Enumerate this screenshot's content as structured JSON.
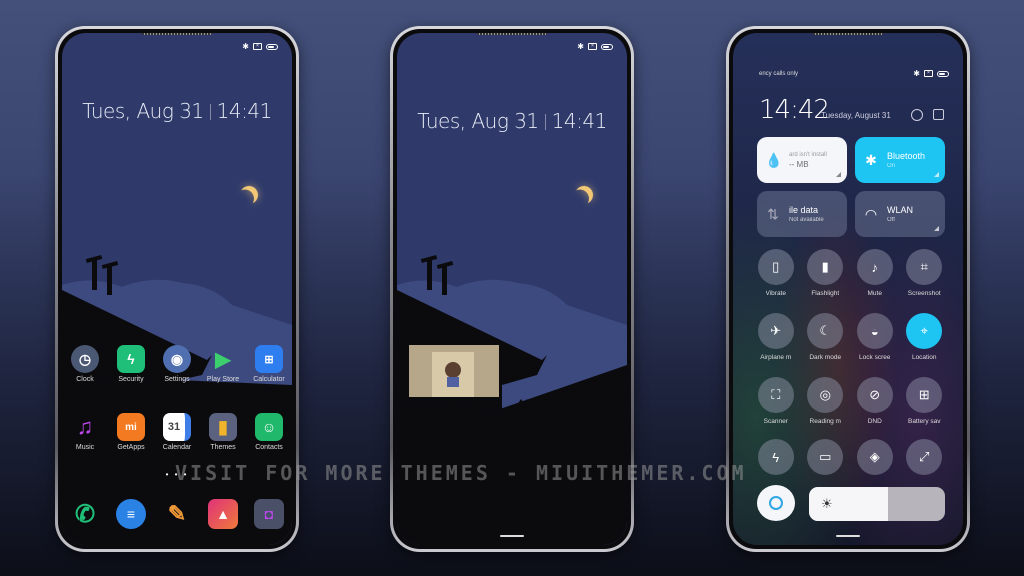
{
  "watermark": "VISIT FOR MORE THEMES - MIUITHEMER.COM",
  "phone1": {
    "status_icons": [
      "bluetooth-icon",
      "sim-icon",
      "battery-icon"
    ],
    "date": "Tues, Aug 31",
    "time": "14:41",
    "apps_row1": [
      {
        "label": "Clock",
        "icon": "clock-icon",
        "color": "#4b5873"
      },
      {
        "label": "Security",
        "icon": "security-icon",
        "color": "#1fbf7a"
      },
      {
        "label": "Settings",
        "icon": "settings-icon",
        "color": "#4f6fb0"
      },
      {
        "label": "Play Store",
        "icon": "play-store-icon",
        "color": "#2a2f40"
      },
      {
        "label": "Calculator",
        "icon": "calculator-icon",
        "color": "#2f7ef0"
      }
    ],
    "apps_row2": [
      {
        "label": "Music",
        "icon": "music-icon",
        "color": "#b43ce0"
      },
      {
        "label": "GetApps",
        "icon": "getapps-icon",
        "color": "#f37a20"
      },
      {
        "label": "Calendar",
        "icon": "calendar-icon",
        "color": "#ffffff"
      },
      {
        "label": "Themes",
        "icon": "themes-icon",
        "color": "#f2b42a"
      },
      {
        "label": "Contacts",
        "icon": "contacts-icon",
        "color": "#20b86a"
      }
    ],
    "calendar_day": "31",
    "dock": [
      {
        "icon": "phone-icon",
        "color": "#1fbf7a"
      },
      {
        "icon": "messages-icon",
        "color": "#2a82e4"
      },
      {
        "icon": "notes-icon",
        "color": "#f29a38"
      },
      {
        "icon": "gallery-icon",
        "color": "#e0327a"
      },
      {
        "icon": "camera-icon",
        "color": "#4a5068"
      }
    ],
    "page_dots": "• • •"
  },
  "phone2": {
    "status_icons": [
      "bluetooth-icon",
      "sim-icon",
      "battery-icon"
    ],
    "date": "Tues, Aug 31",
    "time": "14:41"
  },
  "phone3": {
    "carrier": "ency calls only",
    "time": "14:42",
    "date": "Tuesday, August 31",
    "tiles": {
      "storage": {
        "title": "ard isn't install",
        "sub": "-- MB"
      },
      "bluetooth": {
        "title": "Bluetooth",
        "sub": "On"
      },
      "mobile_data": {
        "title": "ile data",
        "sub": "Not available"
      },
      "wlan": {
        "title": "WLAN",
        "sub": "Off"
      }
    },
    "toggles_row1": [
      {
        "label": "Vibrate",
        "icon": "vibrate-icon",
        "active": false
      },
      {
        "label": "Flashlight",
        "icon": "flashlight-icon",
        "active": false
      },
      {
        "label": "Mute",
        "icon": "mute-icon",
        "active": false
      },
      {
        "label": "Screenshot",
        "icon": "screenshot-icon",
        "active": false
      }
    ],
    "toggles_row2": [
      {
        "label": "Airplane m",
        "icon": "airplane-icon",
        "active": false
      },
      {
        "label": "Dark mode",
        "icon": "dark-mode-icon",
        "active": false
      },
      {
        "label": "Lock scree",
        "icon": "lock-screen-icon",
        "active": false
      },
      {
        "label": "Location",
        "icon": "location-icon",
        "active": true
      }
    ],
    "toggles_row3": [
      {
        "label": "Scanner",
        "icon": "scanner-icon",
        "active": false
      },
      {
        "label": "Reading m",
        "icon": "reading-mode-icon",
        "active": false
      },
      {
        "label": "DND",
        "icon": "dnd-icon",
        "active": false
      },
      {
        "label": "Battery sav",
        "icon": "battery-saver-icon",
        "active": false
      }
    ],
    "toggles_row4": [
      {
        "icon": "power-icon"
      },
      {
        "icon": "cast-icon"
      },
      {
        "icon": "mi-share-icon"
      },
      {
        "icon": "resize-icon"
      }
    ],
    "brightness_percent": 58,
    "accent": "#1ec4f2"
  }
}
